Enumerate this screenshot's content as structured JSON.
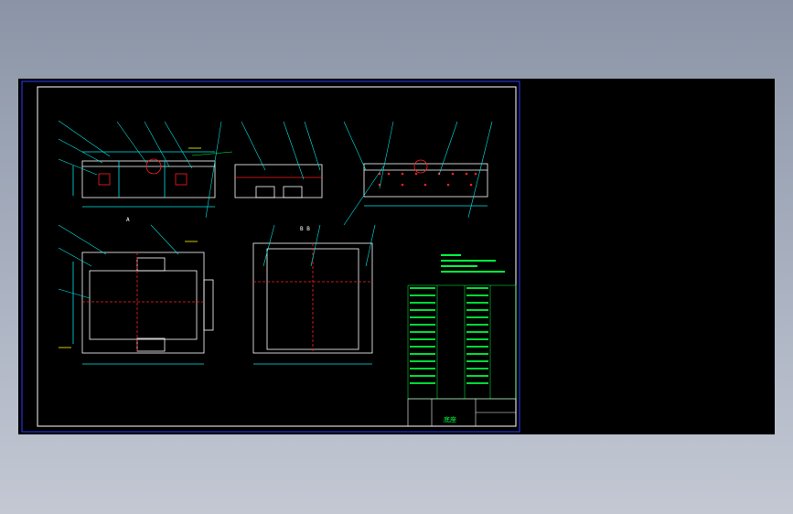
{
  "drawing": {
    "background": "#000000",
    "frame_color": "#2a3cff",
    "line_color_cyan": "#00e5e5",
    "line_color_white": "#ffffff",
    "line_color_red": "#ff2020",
    "text_color_green": "#00ff40",
    "text_color_yellow": "#ffff00",
    "view_label_a": "A",
    "view_label_b": "B  B",
    "title_block_name": "底座"
  }
}
